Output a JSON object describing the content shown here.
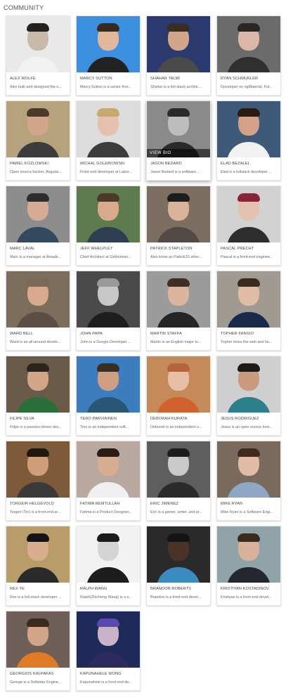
{
  "section": {
    "title": "COMMUNITY"
  },
  "hover_label": "VIEW BIO",
  "members": [
    {
      "name": "ALEX WOLFE",
      "bio": "Alex built and designed the o...",
      "bg": "#e9e9e9",
      "skin": "#c9b9a8",
      "hair": "#222222",
      "shirt": "#f2f2f2"
    },
    {
      "name": "MARCY SUTTON",
      "bio": "Marcy Sutton is a senior fron...",
      "bg": "#3d8fe0",
      "skin": "#e2b79a",
      "hair": "#3a2a1e",
      "shirt": "#222222"
    },
    {
      "name": "SHAHAR TALMI",
      "bio": "Shahar is a full-stack archite...",
      "bg": "#2b3a6e",
      "skin": "#d3a58a",
      "hair": "#3b2c22",
      "shirt": "#4a4a4a"
    },
    {
      "name": "RYAN SCHMUKLER",
      "bio": "Developer on ngMaterial. Ful...",
      "bg": "#6b6b6b",
      "skin": "#dab7a6",
      "hair": "#2b2623",
      "shirt": "#2f2f2f"
    },
    {
      "name": "PAWEL KOZLOWSKI",
      "bio": "Open source hacker, Angular...",
      "bg": "#b6a37d",
      "skin": "#d2a68b",
      "hair": "#4a3a28",
      "shirt": "#3b3b3b"
    },
    {
      "name": "MICHAL GOLEBIOWSKI",
      "bio": "Front-end developer at Labor...",
      "bg": "#dcdcdc",
      "skin": "#e5c0ae",
      "hair": "#c8a86c",
      "shirt": "#3c3c3c"
    },
    {
      "name": "JASON BEDARD",
      "bio": "Jason Bedard is a software ...",
      "bg": "#8a8a8a",
      "skin": "#bdbdbd",
      "hair": "#2a2a2a",
      "shirt": "#2a2a2a"
    },
    {
      "name": "ELAD BEZALEL",
      "bio": "Elad is a fullstack developer ...",
      "bg": "#3e5a78",
      "skin": "#d2a187",
      "hair": "#2a1c12",
      "shirt": "#f1f1f1"
    },
    {
      "name": "MARC LAVAL",
      "bio": "Marc is a manager at Amade...",
      "bg": "#8d8d8d",
      "skin": "#d7ab93",
      "hair": "#2d2d2d",
      "shirt": "#34495e"
    },
    {
      "name": "JEFF WHELPLEY",
      "bio": "Chief Architect at GetHuman...",
      "bg": "#5e7b4f",
      "skin": "#d9a98c",
      "hair": "#4b3a2a",
      "shirt": "#2c3e50"
    },
    {
      "name": "PATRICK STAPLETON",
      "bio": "Also know as PatrickJS wher...",
      "bg": "#7d6e62",
      "skin": "#d9b29c",
      "hair": "#1d1d1d",
      "shirt": "#514a46"
    },
    {
      "name": "PASCAL PRECHT",
      "bio": "Pascal is a front-end enginee...",
      "bg": "#d2d2d2",
      "skin": "#e3c2b0",
      "hair": "#8b2336",
      "shirt": "#2e2e2e"
    },
    {
      "name": "WARD BELL",
      "bio": "Ward is an all-around develo...",
      "bg": "#7c6d5d",
      "skin": "#d8a98c",
      "hair": "#7a6a55",
      "shirt": "#5b4e45"
    },
    {
      "name": "JOHN PAPA",
      "bio": "John is a Google Developer ...",
      "bg": "#4a4a4a",
      "skin": "#c7c7c7",
      "hair": "#9a9a9a",
      "shirt": "#1e1e1e"
    },
    {
      "name": "MARTIN STAFFA",
      "bio": "Martin is an English major tu...",
      "bg": "#9b9b9b",
      "skin": "#dcb59e",
      "hair": "#3d2f26",
      "shirt": "#252525"
    },
    {
      "name": "TOPHER FANGIO",
      "bio": "Topher loves the web and ho...",
      "bg": "#a09a93",
      "skin": "#e2bda6",
      "hair": "#3a2b20",
      "shirt": "#1a2a4a"
    },
    {
      "name": "FILIPE SILVA",
      "bio": "Filipe is a passion-driven dev...",
      "bg": "#6a5a4a",
      "skin": "#d2a488",
      "hair": "#2d241d",
      "shirt": "#2a6e3a"
    },
    {
      "name": "TERO PARVIAINEN",
      "bio": "Tero is an independent soft...",
      "bg": "#3b7dbf",
      "skin": "#cf9f81",
      "hair": "#3c2d22",
      "shirt": "#2a5575"
    },
    {
      "name": "DEBORAH KURATA",
      "bio": "Deborah is an independent s...",
      "bg": "#c48a5a",
      "skin": "#e6bfa6",
      "hair": "#b8643a",
      "shirt": "#d0622e"
    },
    {
      "name": "JESUS RODRIGUEZ",
      "bio": "Jesus is an open source love...",
      "bg": "#cfcfcf",
      "skin": "#c99a7c",
      "hair": "#1d1a18",
      "shirt": "#2e7f8c"
    },
    {
      "name": "TORGEIR HELGEVOLD",
      "bio": "Torgeir (Tor) is a front-end ar...",
      "bg": "#7c5a3a",
      "skin": "#cf9d7a",
      "hair": "#1f1711",
      "shirt": "#3a3a3a"
    },
    {
      "name": "FATIMA REMTULLAH",
      "bio": "Fatima is a Product Designer...",
      "bg": "#b8a8a0",
      "skin": "#d7ad93",
      "hair": "#2a1d17",
      "shirt": "#f0f0f0"
    },
    {
      "name": "ERIC JIMENEZ",
      "bio": "Eric is a gamer, writer, and pr...",
      "bg": "#5e5e5e",
      "skin": "#c9c9c9",
      "hair": "#1d1d1d",
      "shirt": "#2b2b2b"
    },
    {
      "name": "MIKE RYAN",
      "bio": "Mike Ryan is a Software Engi...",
      "bg": "#7a6a5d",
      "skin": "#e1bba5",
      "hair": "#3d2b1e",
      "shirt": "#8ea7c4"
    },
    {
      "name": "REX YE",
      "bio": "Rex is a full-stack developer ...",
      "bg": "#b89d6a",
      "skin": "#d9ae8e",
      "hair": "#141414",
      "shirt": "#2a2a2a"
    },
    {
      "name": "RALPH WANG",
      "bio": "Ralph(Zhicheng Wang) is a s...",
      "bg": "#f2f2f2",
      "skin": "#d4d4d4",
      "hair": "#1b1b1b",
      "shirt": "#1d1d1d"
    },
    {
      "name": "BRANDON ROBERTS",
      "bio": "Brandon is a front-end devel...",
      "bg": "#2a2a2a",
      "skin": "#4a3326",
      "hair": "#141414",
      "shirt": "#3b8bc0"
    },
    {
      "name": "KRISTIYAN KOSTADINOV",
      "bio": "Kristiyan is a front-end devel...",
      "bg": "#8fa3a8",
      "skin": "#d8b19b",
      "hair": "#3a2a1d",
      "shirt": "#24282e"
    },
    {
      "name": "GEORGIOS KALPAKAS",
      "bio": "George is a Software Engine...",
      "bg": "#6e6058",
      "skin": "#d3a588",
      "hair": "#3a2a1f",
      "shirt": "#e07a24"
    },
    {
      "name": "KAPUNAHELE WONG",
      "bio": "Kapunahele is a front-end de...",
      "bg": "#1e2a5a",
      "skin": "#c8b3c8",
      "hair": "#5a4ab0",
      "shirt": "#2d2a60"
    }
  ],
  "hovered_index": 6
}
